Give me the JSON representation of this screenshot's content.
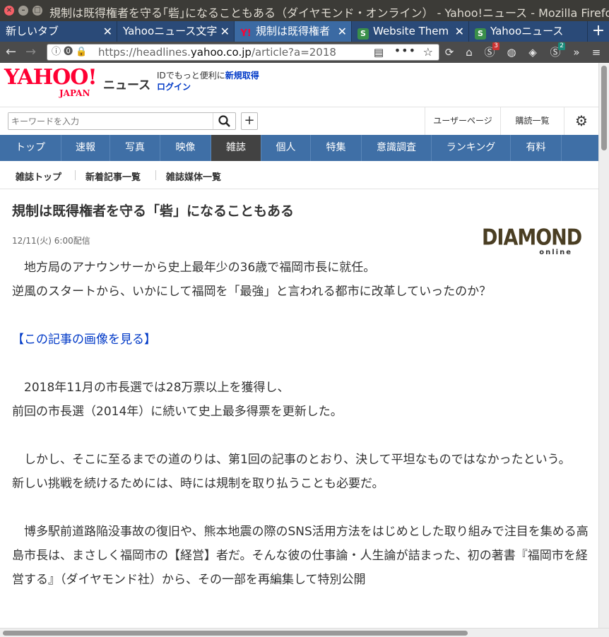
{
  "window": {
    "title": "規制は既得権者を守る｢砦｣になることもある（ダイヤモンド・オンライン） - Yahoo!ニュース - Mozilla Firefox"
  },
  "tabs": [
    {
      "label": "新しいタブ"
    },
    {
      "label": "Yahooニュース文字"
    },
    {
      "label": "規制は既得権者"
    },
    {
      "label": "Website Them"
    },
    {
      "label": "Yahooニュース"
    }
  ],
  "toolbar": {
    "url_prefix": "https://headlines.",
    "url_domain": "yahoo.co.jp",
    "url_suffix": "/article?a=2018",
    "ext_badges": [
      "3",
      "2"
    ]
  },
  "header": {
    "logo_text": "YAHOO!",
    "logo_sub": "JAPAN",
    "service": "ニュース",
    "id_prompt": "IDでもっと便利に",
    "register_link": "新規取得",
    "login_link": "ログイン"
  },
  "search": {
    "placeholder": "キーワードを入力",
    "user_page": "ユーザーページ",
    "subscriptions": "購読一覧"
  },
  "categories": [
    "トップ",
    "速報",
    "写真",
    "映像",
    "雑誌",
    "個人",
    "特集",
    "意識調査",
    "ランキング",
    "有料"
  ],
  "subnav": [
    "雑誌トップ",
    "新着記事一覧",
    "雑誌媒体一覧"
  ],
  "article": {
    "headline": "規制は既得権者を守る「砦」になることもある",
    "date": "12/11(火) 6:00配信",
    "source_logo": "DIAMOND",
    "source_logo_sub": "online",
    "paragraphs": [
      "　地方局のアナウンサーから史上最年少の36歳で福岡市長に就任。",
      "逆風のスタートから、いかにして福岡を「最強」と言われる都市に改革していったのか？",
      "",
      "【この記事の画像を見る】",
      "",
      "　2018年11月の市長選では28万票以上を獲得し、",
      "前回の市長選（2014年）に続いて史上最多得票を更新した。",
      "",
      "　しかし、そこに至るまでの道のりは、第1回の記事のとおり、決して平坦なものではなかったという。",
      "新しい挑戦を続けるためには、時には規制を取り払うことも必要だ。",
      "",
      "　博多駅前道路陥没事故の復旧や、熊本地震の際のSNS活用方法をはじめとした取り組みで注目を集める高島市長は、まさしく福岡市の【経営】者だ。そんな彼の仕事論・人生論が詰まった、初の著書『福岡市を経営する』（ダイヤモンド社）から、その一部を再編集して特別公開"
    ]
  }
}
